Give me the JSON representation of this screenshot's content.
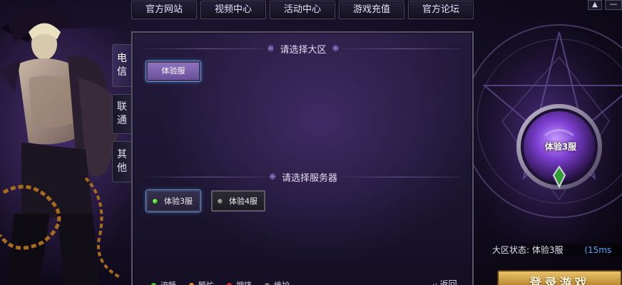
{
  "nav": {
    "items": [
      {
        "label": "官方网站"
      },
      {
        "label": "视频中心"
      },
      {
        "label": "活动中心"
      },
      {
        "label": "游戏充值"
      },
      {
        "label": "官方论坛"
      }
    ]
  },
  "window_controls": {
    "sound_icon": "speaker-icon",
    "minimize_label": "—"
  },
  "side_tabs": [
    {
      "chars": [
        "电",
        "信"
      ],
      "active": true
    },
    {
      "chars": [
        "联",
        "通"
      ],
      "active": false
    },
    {
      "chars": [
        "其",
        "他"
      ],
      "active": false
    }
  ],
  "region_section": {
    "title": "请选择大区",
    "regions": [
      {
        "label": "体验服",
        "selected": true
      }
    ]
  },
  "server_section": {
    "title": "请选择服务器",
    "servers": [
      {
        "label": "体验3服",
        "selected": true,
        "status_color": "#3cae2b"
      },
      {
        "label": "体验4服",
        "selected": false,
        "status_color": "#6f6f6f"
      }
    ]
  },
  "legend": [
    {
      "label": "流畅",
      "color": "#3cc12b"
    },
    {
      "label": "繁忙",
      "color": "#e08a1e"
    },
    {
      "label": "拥挤",
      "color": "#d42a2a"
    },
    {
      "label": "维护",
      "color": "#777777"
    }
  ],
  "back": {
    "label": "返回",
    "icon": "back-arrow-icon"
  },
  "selected_server": {
    "name": "体验3服"
  },
  "status": {
    "label": "大区状态:",
    "value": "体验3服",
    "latency": "(15ms"
  },
  "login": {
    "label": "登录游戏"
  }
}
